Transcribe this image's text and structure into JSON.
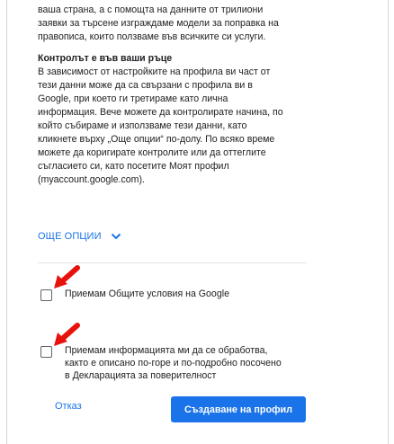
{
  "intro_text": "ваша страна, а с помощта на данните от трилиони\nзаявки за търсене изграждаме модели за поправка на\nправописа, които ползваме във всичките си услуги.",
  "control_heading": "Контролът е във ваши ръце",
  "control_text": "В зависимост от настройките на профила ви част от\nтези данни може да са свързани с профила ви в\nGoogle, при което ги третираме като лична\nинформация. Вече можете да контролирате начина, по\nкойто събираме и използваме тези данни, като\nкликнете върху „Още опции“ по-долу. По всяко време\nможете да коригирате контролите или да оттеглите\nсъгласието си, като посетите Моят профил\n(myaccount.google.com).",
  "more_options": {
    "label": "ОЩЕ ОПЦИИ",
    "icon": "chevron-down-icon"
  },
  "checkboxes": [
    {
      "label": "Приемам Общите условия на Google",
      "checked": false
    },
    {
      "label": "Приемам информацията ми да се обработва,\nкакто е описано по-горе и по-подробно посочено\nв Декларацията за поверителност",
      "checked": false
    }
  ],
  "annotation_arrow": {
    "color": "#e8120c"
  },
  "footer": {
    "cancel_label": "Отказ",
    "create_label": "Създаване на профил"
  },
  "colors": {
    "accent": "#1a73e8",
    "text": "#202124"
  }
}
